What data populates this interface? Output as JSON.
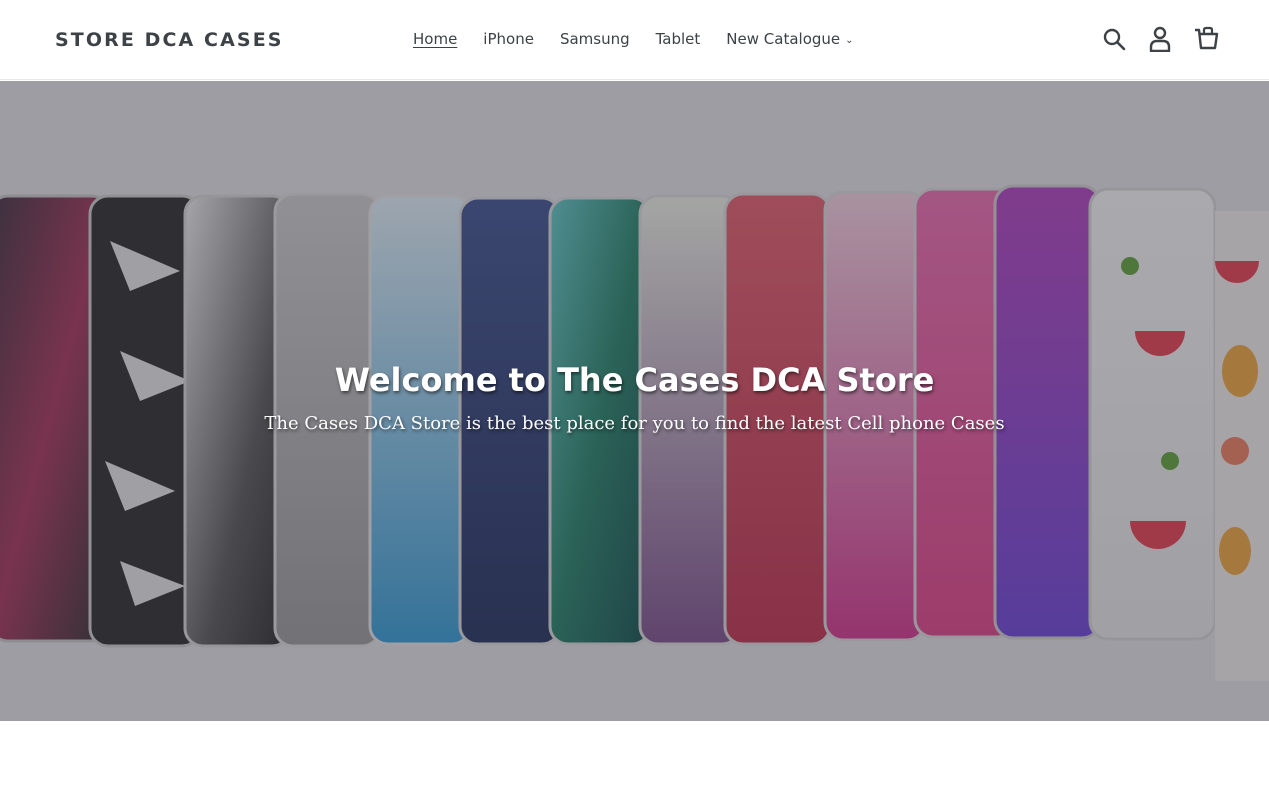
{
  "header": {
    "logo": "STORE DCA CASES",
    "nav": [
      {
        "label": "Home",
        "active": true
      },
      {
        "label": "iPhone",
        "active": false
      },
      {
        "label": "Samsung",
        "active": false
      },
      {
        "label": "Tablet",
        "active": false
      },
      {
        "label": "New Catalogue",
        "active": false,
        "dropdown": true
      }
    ],
    "icons": [
      "search-icon",
      "account-icon",
      "cart-icon"
    ]
  },
  "hero": {
    "title": "Welcome to The Cases DCA Store",
    "subtitle": "The Cases DCA Store is the best place for you to find the latest Cell phone Cases"
  },
  "colors": {
    "text": "#3d4246",
    "overlay": "rgba(60,60,70,0.42)",
    "hero_text": "#ffffff"
  }
}
